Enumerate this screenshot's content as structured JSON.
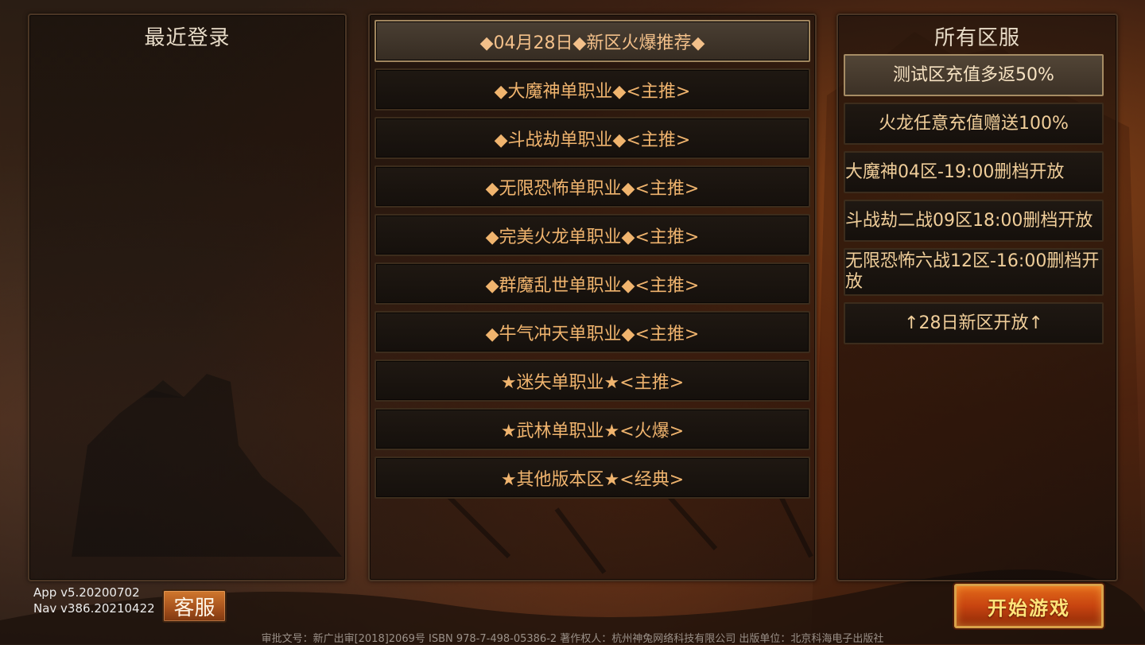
{
  "left_panel": {
    "title": "最近登录"
  },
  "middle_panel": {
    "zones": [
      {
        "label": "◆04月28日◆新区火爆推荐◆",
        "selected": true
      },
      {
        "label": "◆大魔神单职业◆<主推>",
        "selected": false
      },
      {
        "label": "◆斗战劫单职业◆<主推>",
        "selected": false
      },
      {
        "label": "◆无限恐怖单职业◆<主推>",
        "selected": false
      },
      {
        "label": "◆完美火龙单职业◆<主推>",
        "selected": false
      },
      {
        "label": "◆群魔乱世单职业◆<主推>",
        "selected": false
      },
      {
        "label": "◆牛气冲天单职业◆<主推>",
        "selected": false
      },
      {
        "label": "★迷失单职业★<主推>",
        "selected": false
      },
      {
        "label": "★武林单职业★<火爆>",
        "selected": false
      },
      {
        "label": "★其他版本区★<经典>",
        "selected": false
      }
    ]
  },
  "right_panel": {
    "title": "所有区服",
    "servers": [
      {
        "label": "测试区充值多返50%",
        "selected": true
      },
      {
        "label": "火龙任意充值赠送100%",
        "selected": false
      },
      {
        "label": "大魔神04区-19:00删档开放",
        "selected": false
      },
      {
        "label": "斗战劫二战09区18:00删档开放",
        "selected": false
      },
      {
        "label": "无限恐怖六战12区-16:00删档开放",
        "selected": false
      },
      {
        "label": "↑28日新区开放↑",
        "selected": false
      }
    ]
  },
  "version": {
    "app": "App v5.20200702",
    "nav": "Nav v386.20210422"
  },
  "buttons": {
    "support": "客服",
    "start": "开始游戏"
  },
  "footer": "审批文号：新广出审[2018]2069号 ISBN 978-7-498-05386-2 著作权人：杭州神兔网络科技有限公司 出版单位：北京科海电子出版社",
  "colors": {
    "zone_text": "#f0b46e",
    "server_text": "#f0ce9a",
    "start_button": "#c74410",
    "support_button": "#a4501c"
  }
}
